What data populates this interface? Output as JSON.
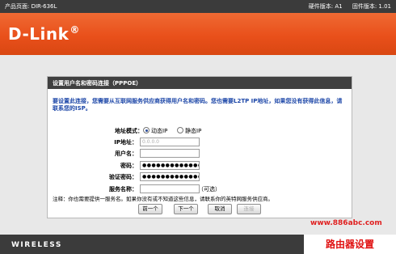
{
  "topbar": {
    "product_page": "产品页面: DIR-636L",
    "hardware_version": "硬件版本: A1",
    "firmware_version": "固件版本: 1.01"
  },
  "logo": {
    "text": "D-Link",
    "dot": "®"
  },
  "panel": {
    "title": "设置用户名和密码连接（PPPOE）",
    "intro": "要设置此连接，您需要从互联网服务供应商获得用户名和密码。您也需要L2TP IP地址，如果您没有获得此信息，请联系您的ISP。"
  },
  "form": {
    "mode_label": "地址模式：",
    "mode_options": [
      "动态IP",
      "静态IP"
    ],
    "mode_selected": "动态IP",
    "ip_label": "IP地址：",
    "ip_placeholder": "0.0.0.0",
    "username_label": "用户名：",
    "username_value": "",
    "password_label": "密码：",
    "password_value": "●●●●●●●●●●●●●●●●●●●●",
    "verify_label": "验证密码：",
    "verify_value": "●●●●●●●●●●●●●●●●●●●●",
    "service_label": "服务名称：",
    "service_value": "",
    "optional": "（可选）"
  },
  "note": "注释：你也需要提供一服务名。如果你没有或不知道这些信息，请联系你的英特网服务供应商。",
  "buttons": {
    "prev": "前一个",
    "next": "下一个",
    "cancel": "取消",
    "connect": "连接"
  },
  "footer": {
    "brand": "WIRELESS"
  },
  "watermark": {
    "url": "www.886abc.com",
    "text": "路由器设置"
  },
  "colors": {
    "banner": "#e9501b",
    "topbar": "#3b3b3b",
    "intro_text": "#1d47a8",
    "watermark": "#e01010"
  }
}
